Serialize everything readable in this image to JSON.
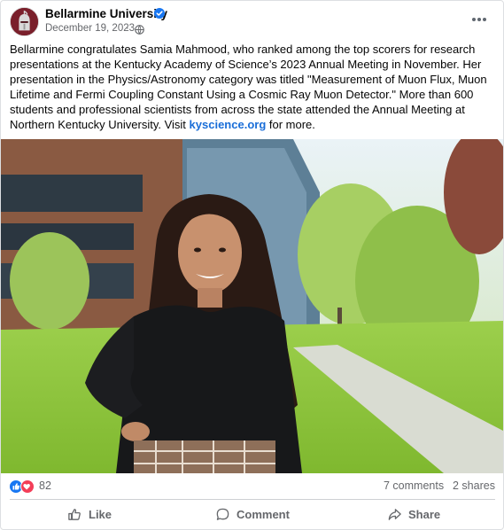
{
  "post": {
    "page_name": "Bellarmine University",
    "date": "December 19, 2023",
    "date_separator": "·",
    "text_before_link": "Bellarmine congratulates Samia Mahmood, who ranked among the top scorers for research presentations at the Kentucky Academy of Science’s 2023 Annual Meeting in November. Her presentation in the Physics/Astronomy category was titled \"Measurement of Muon Flux, Muon Lifetime and Fermi Coupling Constant Using a Cosmic Ray Muon Detector.\" More than 600 students and professional scientists from across the state attended the Annual Meeting at Northern Kentucky University. Visit ",
    "link_text": "kyscience.org",
    "text_after_link": " for more."
  },
  "stats": {
    "reaction_count": "82",
    "comments": "7 comments",
    "shares": "2 shares"
  },
  "actions": {
    "like": "Like",
    "comment": "Comment",
    "share": "Share"
  },
  "icons": {
    "avatar": "bellarmine-knight-logo",
    "verified": "verified-badge-icon",
    "privacy": "globe-icon",
    "more": "more-options-icon",
    "like_reaction": "thumbs-up-icon",
    "love_reaction": "heart-icon"
  },
  "colors": {
    "brand_blue": "#1877f2",
    "love_red": "#f33e58",
    "link": "#1a6ed8",
    "secondary_text": "#65676b",
    "avatar_bg": "#7a1f2b"
  }
}
